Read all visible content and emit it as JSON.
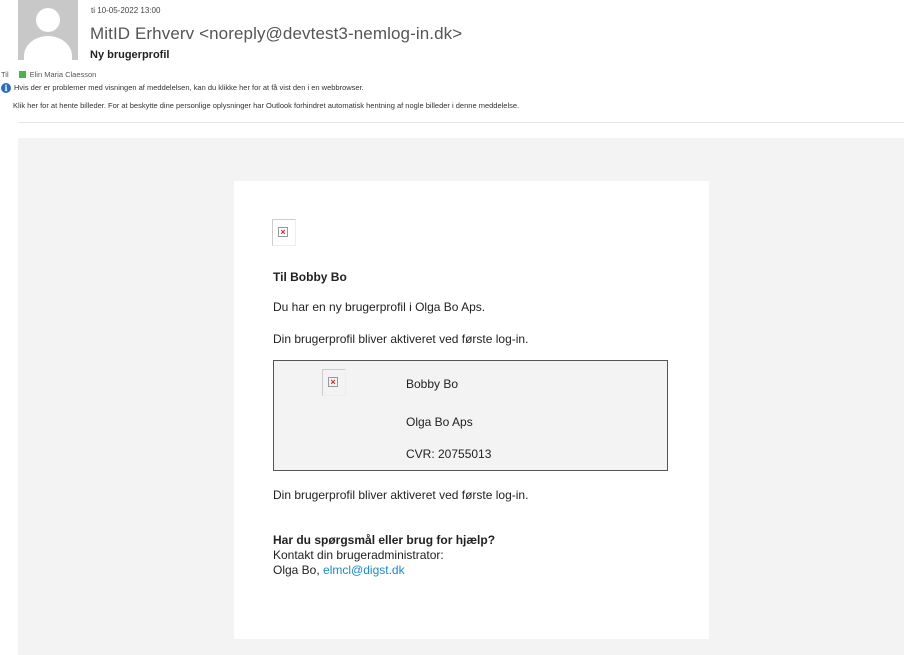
{
  "header": {
    "date": "ti 10-05-2022 13:00",
    "sender": "MitID Erhverv <noreply@devtest3-nemlog-in.dk>",
    "subject": "Ny brugerprofil",
    "to_label": "Til",
    "recipient": "Elin Maria Claesson",
    "info_line1": "Hvis der er problemer med visningen af meddelelsen, kan du klikke her for at få vist den i en webbrowser.",
    "info_line2": "Klik her for at hente billeder. For at beskytte dine personlige oplysninger har Outlook forhindret automatisk hentning af nogle billeder i denne meddelelse."
  },
  "body": {
    "greeting": "Til Bobby Bo",
    "line1": "Du har en ny brugerprofil i Olga Bo Aps.",
    "line2": "Din brugerprofil bliver aktiveret ved første log-in.",
    "profile": {
      "name": "Bobby Bo",
      "company": "Olga Bo Aps",
      "cvr": "CVR: 20755013"
    },
    "line3": "Din brugerprofil bliver aktiveret ved første log-in.",
    "help_heading": "Har du spørgsmål eller brug for hjælp?",
    "contact_label": "Kontakt din brugeradministrator:",
    "contact_name": "Olga Bo,",
    "contact_email": "elmcl@digst.dk"
  },
  "colors": {
    "link": "#1a8ad4",
    "presence": "#43b649",
    "info_icon": "#2b6cc4"
  },
  "icons": [
    "avatar-placeholder-icon",
    "presence-available-icon",
    "info-icon",
    "broken-image-icon"
  ]
}
